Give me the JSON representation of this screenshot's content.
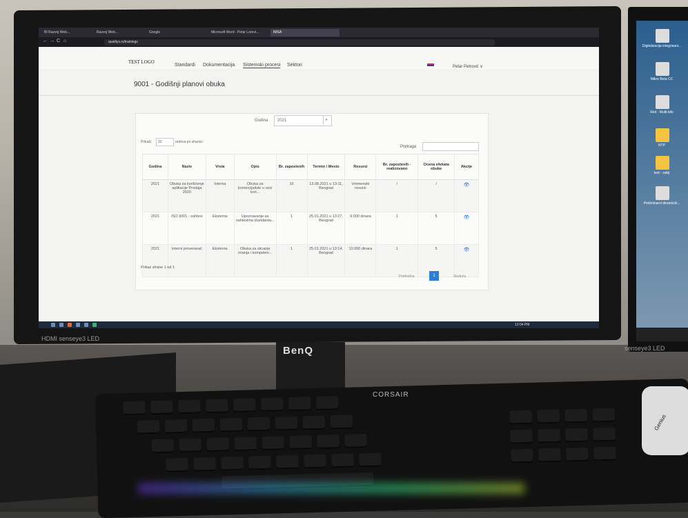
{
  "browser": {
    "tabs": [
      {
        "label": "BI Razvoj Web..."
      },
      {
        "label": "Razvoj Web..."
      },
      {
        "label": "Google"
      },
      {
        "label": "Microsoft Word - Petar Lorevi..."
      },
      {
        "label": "IMSA"
      }
    ],
    "url": "qualityx.rs/trainings",
    "nav_back": "←",
    "nav_forward": "→",
    "nav_reload": "C",
    "nav_home": "⌂"
  },
  "app": {
    "logo": "TEST LOGO",
    "menu": [
      {
        "label": "Standardi"
      },
      {
        "label": "Dokumentacija"
      },
      {
        "label": "Sistemski procesi"
      },
      {
        "label": "Sektori"
      }
    ],
    "user": "Petar Petrović ∨",
    "page_title": "9001 - Godišnji planovi obuka"
  },
  "filter": {
    "godina_label": "Godina",
    "godina_value": "2021"
  },
  "table_controls": {
    "show_prefix": "Prikaži",
    "per_page": "10",
    "show_suffix": "redova po stranici",
    "search_label": "Pretraga"
  },
  "table": {
    "headers": [
      "Godina",
      "Naziv",
      "Vrsta",
      "Opis",
      "Br. zaposlenih",
      "Termin / Mesto",
      "Resursi",
      "Br. zaposlenih - realizovano",
      "Ocena efekata obuke",
      "Akcije"
    ],
    "rows": [
      [
        "2021",
        "Obuka za korišćenje aplikacije Prodaja 2020",
        "Interna",
        "Obuka za komercijaliste u vezi kori...",
        "10",
        "13.08.2021 u 13:11, Beograd",
        "Vremenski resursi",
        "/",
        "/",
        "👁"
      ],
      [
        "2021",
        "ISO 9001 - zahtevi",
        "Eksterna",
        "Upoznavanje sa zahtevima standarda...",
        "1",
        "25.01.2021 u 13:27, Beograd",
        "9.000 dinara",
        "1",
        "5",
        "👁"
      ],
      [
        "2021",
        "Interni proveravač",
        "Eksterna",
        "Obuka za sticanje znanja i kompeten...",
        "1",
        "25.01.2021 u 13:14, Beograd",
        "10.000 dinara",
        "1",
        "5",
        "👁"
      ]
    ]
  },
  "pagination": {
    "info": "Prikaz strane 1 od 1",
    "prev": "Prethodna",
    "current": "1",
    "next": "Sledeća"
  },
  "taskbar": {
    "time": "12:04 PM"
  },
  "hardware": {
    "monitor_brand": "BenQ",
    "monitor_label": "HDMI senseye3 LED",
    "keyboard_brand": "CORSAIR",
    "right_monitor_label": "senseye3 LED",
    "mouse_brand": "Genius"
  },
  "right_desktop_icons": [
    {
      "label": "Digitalizacija integrisani..."
    },
    {
      "label": "Mikro Beta CC"
    },
    {
      "label": "Red - Multi-bilo"
    },
    {
      "label": "NTP"
    },
    {
      "label": "test - zaklj"
    },
    {
      "label": "Preliminarni dinamicki..."
    }
  ]
}
